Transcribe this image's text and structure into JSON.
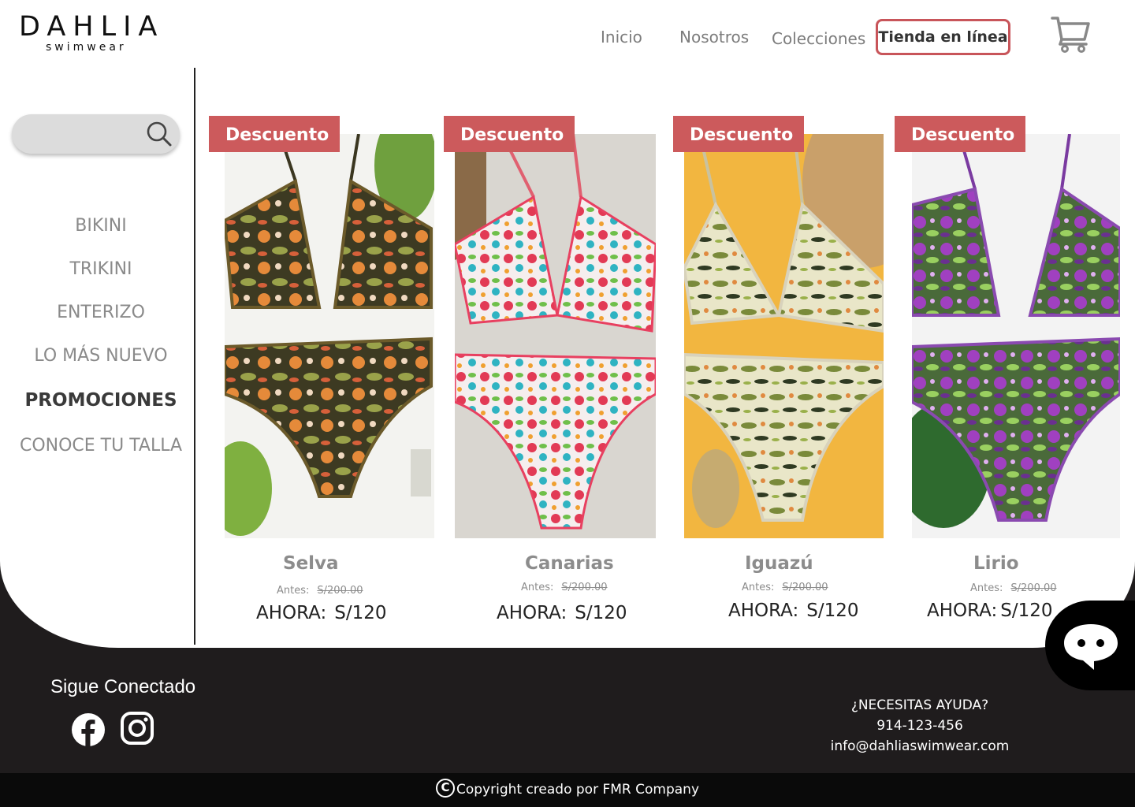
{
  "brand": {
    "name": "DAHLIA",
    "tagline": "swimwear"
  },
  "nav": {
    "items": [
      {
        "label": "Inicio"
      },
      {
        "label": "Nosotros"
      },
      {
        "label": "Colecciones"
      },
      {
        "label": "Tienda en línea",
        "active": true
      }
    ],
    "cart_icon": "shopping-cart-icon"
  },
  "search": {
    "placeholder": "",
    "icon": "search-icon"
  },
  "categories": [
    {
      "label": "BIKINI"
    },
    {
      "label": "TRIKINI"
    },
    {
      "label": "ENTERIZO"
    },
    {
      "label": "LO MÁS NUEVO"
    },
    {
      "label": "PROMOCIONES",
      "active": true
    },
    {
      "label": "CONOCE TU TALLA"
    }
  ],
  "products": [
    {
      "badge": "Descuento",
      "name": "Selva",
      "antes_label": "Antes:",
      "old_price": "S/200.00",
      "ahora_label": "AHORA:",
      "price": "S/120"
    },
    {
      "badge": "Descuento",
      "name": "Canarias",
      "antes_label": "Antes:",
      "old_price": "S/200.00",
      "ahora_label": "AHORA:",
      "price": "S/120"
    },
    {
      "badge": "Descuento",
      "name": "Iguazú",
      "antes_label": "Antes:",
      "old_price": "S/200.00",
      "ahora_label": "AHORA:",
      "price": "S/120"
    },
    {
      "badge": "Descuento",
      "name": "Lirio",
      "antes_label": "Antes:",
      "old_price": "S/200.00",
      "ahora_label": "AHORA:",
      "price": "S/120"
    }
  ],
  "chat": {
    "icon": "chat-bubble-icon"
  },
  "footer": {
    "follow_label": "Sigue Conectado",
    "social_icons": [
      "facebook-icon",
      "instagram-icon"
    ],
    "help_title": "¿NECESITAS AYUDA?",
    "phone": "914-123-456",
    "email": "info@dahliaswimwear.com",
    "copyright_symbol": "C",
    "copyright": "Copyright creado por FMR Company"
  },
  "colors": {
    "accent": "#cc5a5c",
    "footer_bg": "#1f1c1d",
    "text_muted": "#8a8a8a"
  }
}
